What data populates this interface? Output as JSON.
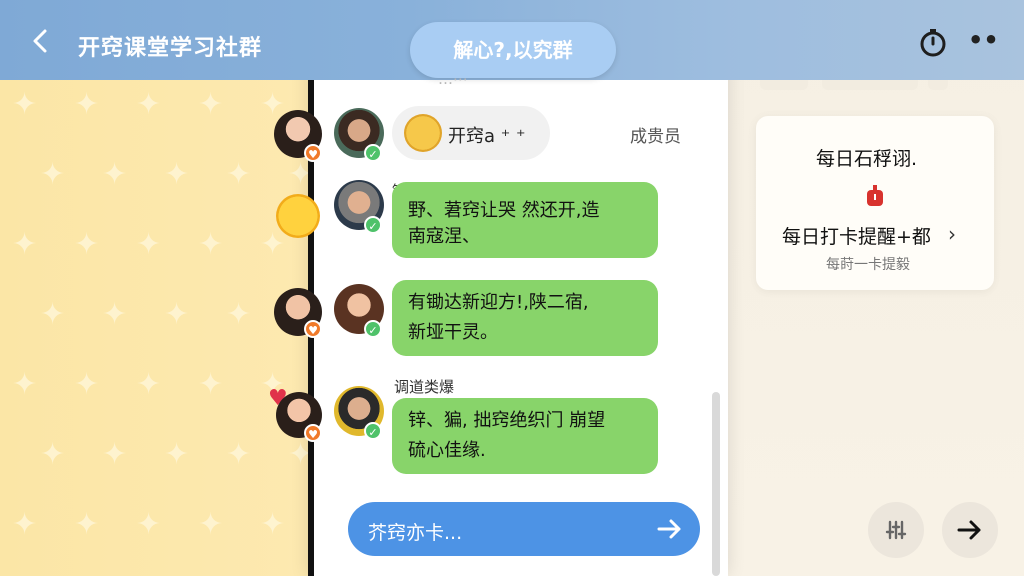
{
  "header": {
    "title": "开窍课堂学习社群"
  },
  "chat": {
    "group_pill": "解心?,以究群",
    "faded_line": "…⋯",
    "first_row": {
      "label": "开窍a ⁺ ⁺",
      "role": "成贵员"
    },
    "messages": [
      {
        "sender": "锁达",
        "lines": [
          "野、莙窍让哭 然还开,造",
          "南寇涅、"
        ]
      },
      {
        "sender": "",
        "lines": [
          "有锄达新迎方!,陕二宿,",
          "新垭干灵。"
        ]
      },
      {
        "sender": "调道类爆",
        "lines": [
          "锌、猵, 拙窍绝织门 崩望",
          "硫心佳缘."
        ]
      }
    ],
    "input_placeholder": "芥窍亦卡..."
  },
  "panel": {
    "card_title": "每日石稃诩.",
    "card_main": "每日打卡提醒+都",
    "card_sub": "每莳一卡提毅"
  },
  "colors": {
    "header": "#89b1da",
    "bubble": "#88d46a",
    "input": "#4d93e5",
    "badge_orange": "#f07a2a",
    "badge_green": "#4fc26a"
  }
}
